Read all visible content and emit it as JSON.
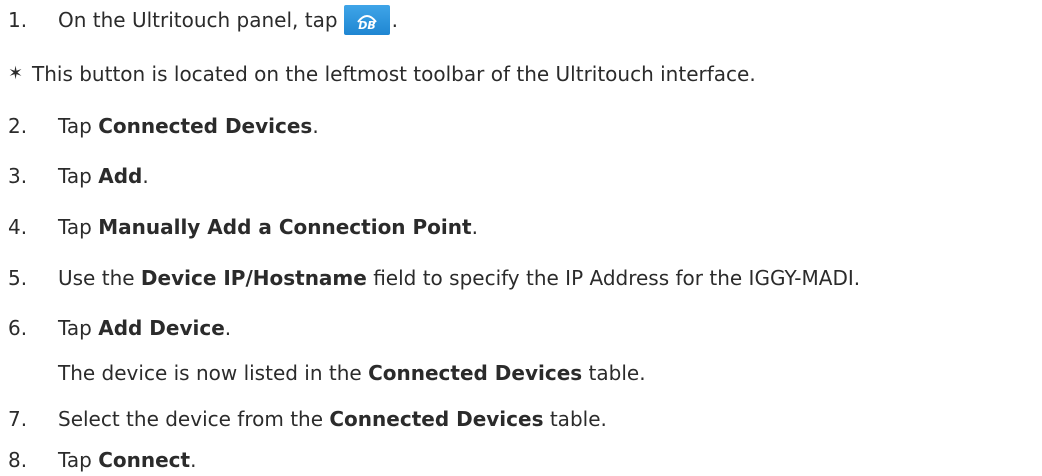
{
  "steps": [
    {
      "num": "1.",
      "pre": "On the Ultritouch panel, tap",
      "post": "."
    },
    {
      "num": "2.",
      "pre": "Tap ",
      "bold": "Connected Devices",
      "post": "."
    },
    {
      "num": "3.",
      "pre": "Tap ",
      "bold": "Add",
      "post": "."
    },
    {
      "num": "4.",
      "pre": "Tap ",
      "bold": "Manually Add a Connection Point",
      "post": "."
    },
    {
      "num": "5.",
      "pre": "Use the ",
      "bold": "Device IP/Hostname",
      "post": " field to specify the IP Address for the IGGY-MADI."
    },
    {
      "num": "6.",
      "pre": "Tap ",
      "bold": "Add Device",
      "post": "."
    },
    {
      "num": "7.",
      "pre": "Select the device from the ",
      "bold": "Connected Devices",
      "post": " table."
    },
    {
      "num": "8.",
      "pre": "Tap ",
      "bold": "Connect",
      "post": "."
    }
  ],
  "note": {
    "star": "✶",
    "text": "This button is located on the leftmost toolbar of the Ultritouch interface."
  },
  "step6_result": {
    "pre": "The device is now listed in the ",
    "bold": "Connected Devices",
    "post": " table."
  },
  "db_icon": {
    "icon": "db-icon",
    "label": "DB",
    "color": "#2a95dd"
  }
}
